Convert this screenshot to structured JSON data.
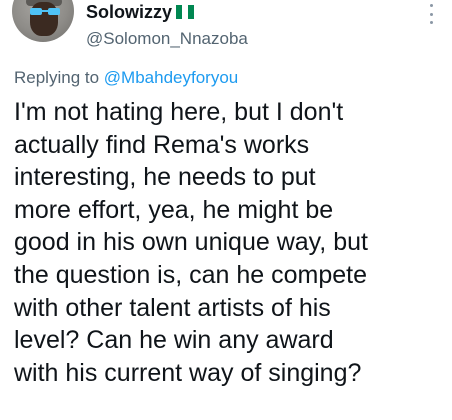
{
  "author": {
    "display_name": "Solowizzy",
    "handle": "@Solomon_Nnazoba",
    "flag_colors": [
      "#008751",
      "#ffffff",
      "#008751"
    ]
  },
  "reply": {
    "prefix": "Replying to",
    "mention": "@Mbahdeyforyou"
  },
  "tweet_lines": [
    "I'm not hating here, but I don't",
    "actually find Rema's works",
    "interesting, he needs to put",
    "more effort, yea, he might be",
    "good in his own unique way, but",
    "the question is, can he compete",
    "with other talent artists of his",
    "level? Can he win any award",
    "with his current way of singing?"
  ],
  "icons": {
    "more": "more-vertical-icon",
    "shades": "sunglasses-emoji-icon"
  },
  "colors": {
    "text": "#0f1419",
    "muted": "#536471",
    "link": "#1d9bf0"
  }
}
